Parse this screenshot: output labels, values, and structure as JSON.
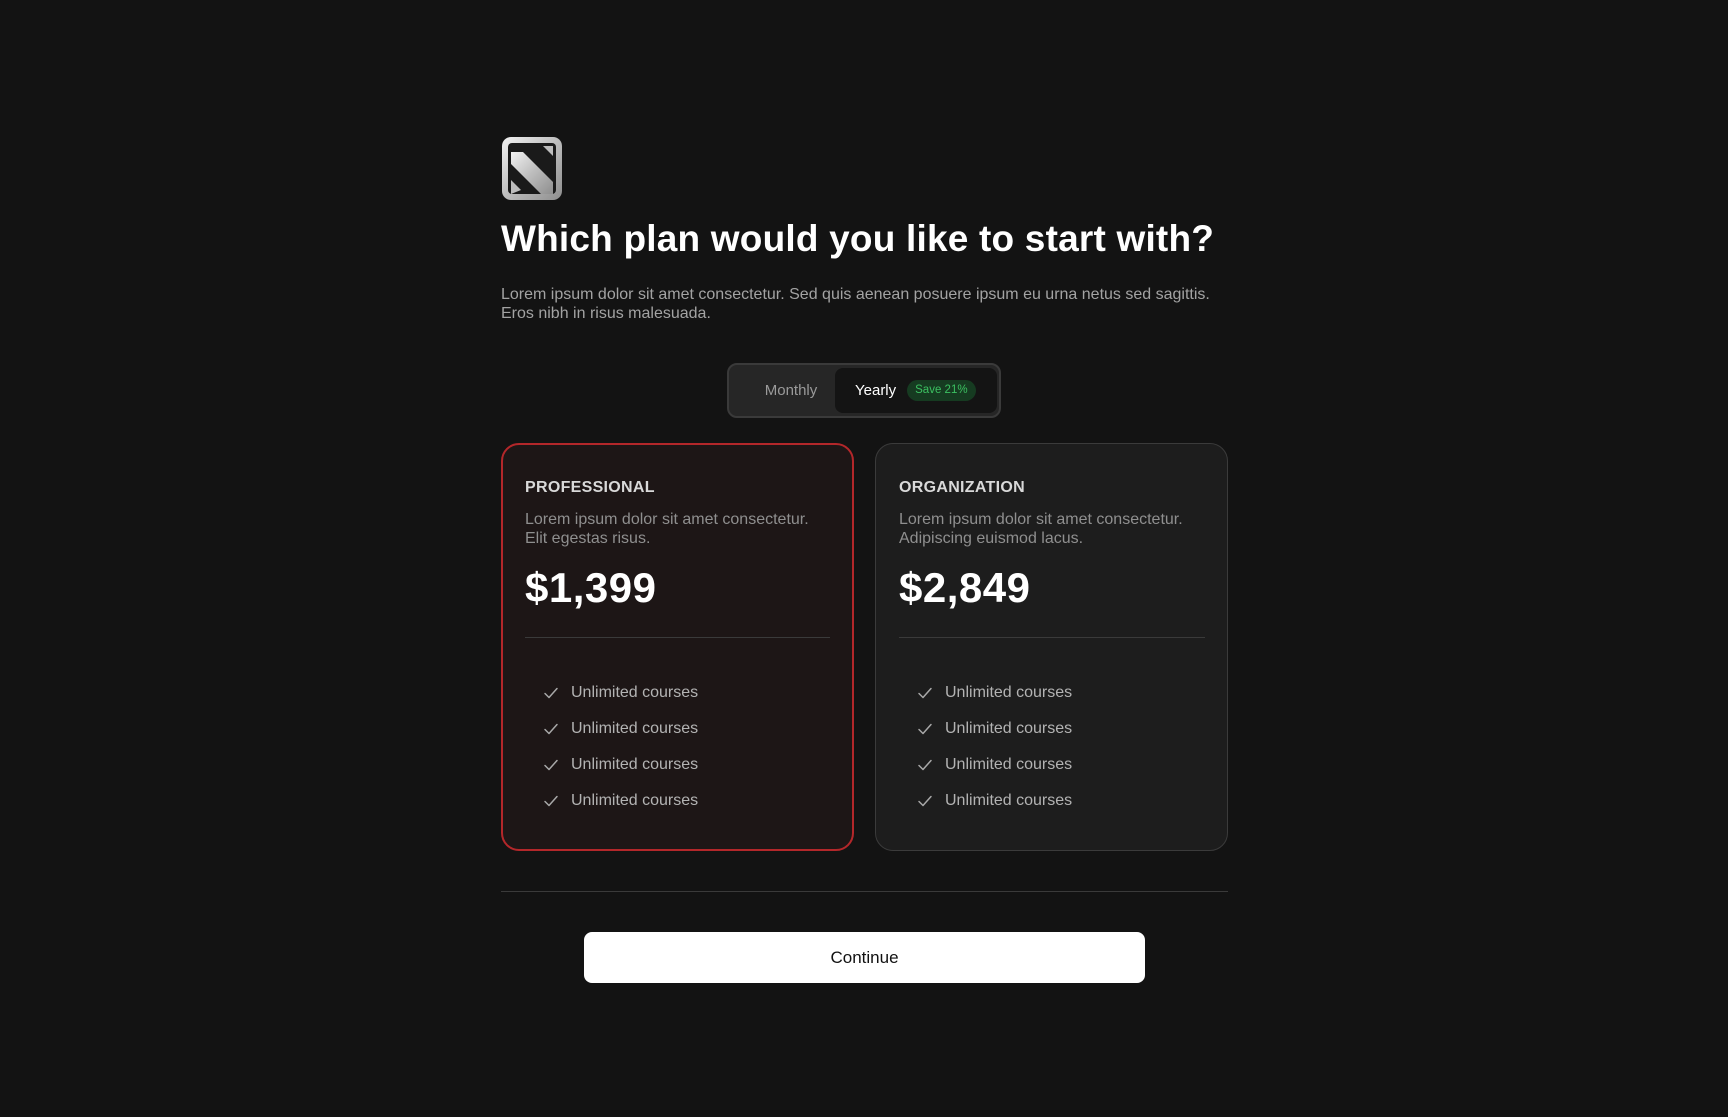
{
  "header": {
    "logo_icon": "brand-logo-icon",
    "title": "Which plan would you like to start with?",
    "subtitle": "Lorem ipsum dolor sit amet consectetur. Sed quis aenean posuere ipsum eu urna netus sed sagittis. Eros nibh in risus malesuada."
  },
  "billing_toggle": {
    "options": [
      "Monthly",
      "Yearly"
    ],
    "selected": "Yearly",
    "monthly_label": "Monthly",
    "yearly_label": "Yearly",
    "save_badge": "Save 21%",
    "badge_color": "#3cc061"
  },
  "plans": [
    {
      "name": "PROFESSIONAL",
      "description": "Lorem ipsum dolor sit amet consectetur. Elit egestas risus.",
      "price": "$1,399",
      "selected": true,
      "accent_color": "#b3272a",
      "features": [
        "Unlimited courses",
        "Unlimited courses",
        "Unlimited courses",
        "Unlimited courses"
      ]
    },
    {
      "name": "ORGANIZATION",
      "description": "Lorem ipsum dolor sit amet consectetur. Adipiscing euismod lacus.",
      "price": "$2,849",
      "selected": false,
      "features": [
        "Unlimited courses",
        "Unlimited courses",
        "Unlimited courses",
        "Unlimited courses"
      ]
    }
  ],
  "footer": {
    "continue_label": "Continue"
  },
  "colors": {
    "background": "#131313",
    "selected_border": "#b3272a"
  }
}
